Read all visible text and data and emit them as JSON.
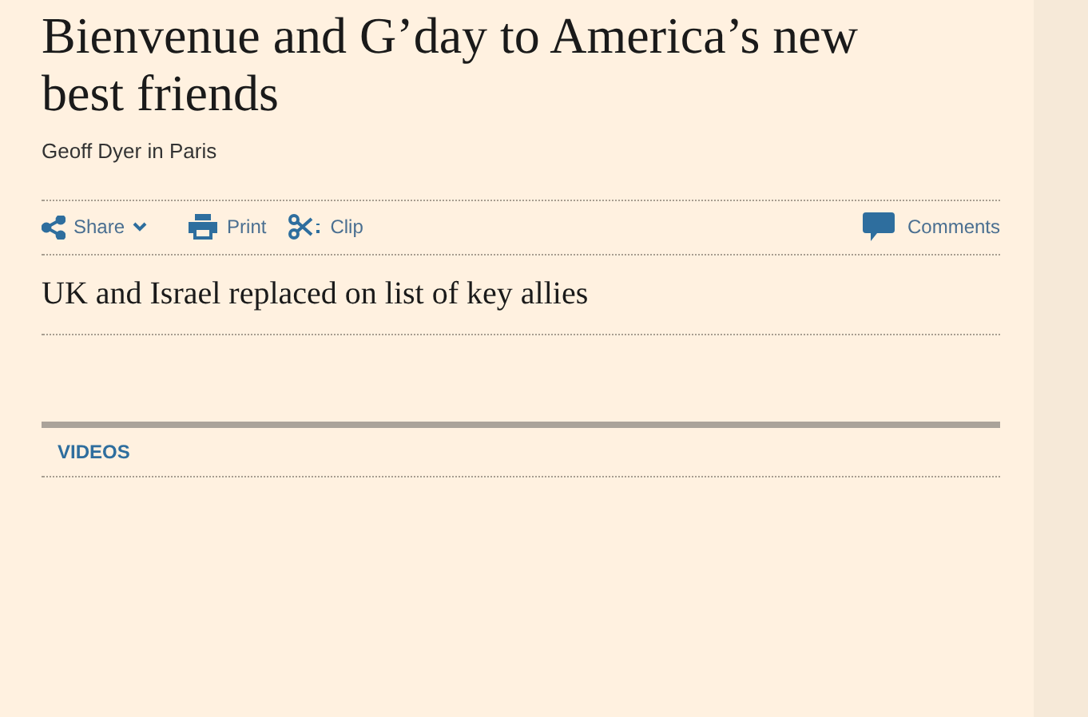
{
  "article": {
    "title": "Bienvenue and G’day to America’s new best friends",
    "byline": "Geoff Dyer in Paris"
  },
  "toolbar": {
    "share": "Share",
    "print": "Print",
    "clip": "Clip",
    "comments": "Comments"
  },
  "related": {
    "headline": "UK and Israel replaced on list of key allies"
  },
  "videos": {
    "heading": "VIDEOS"
  }
}
